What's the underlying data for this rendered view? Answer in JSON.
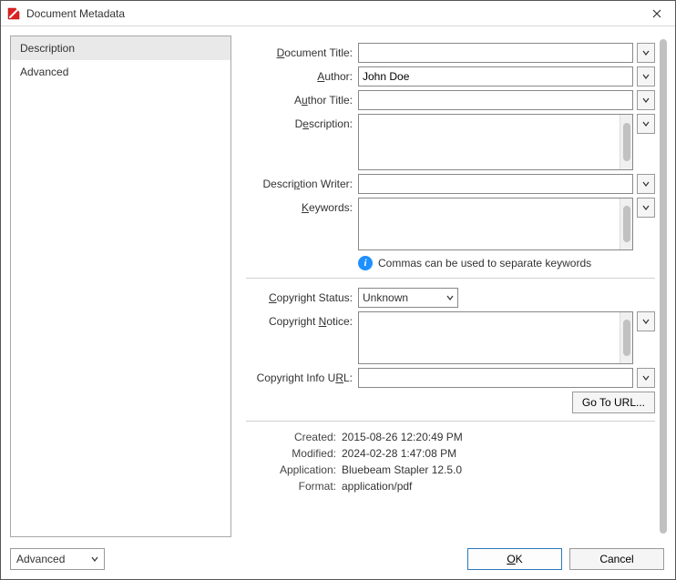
{
  "window": {
    "title": "Document Metadata"
  },
  "sidebar": {
    "items": [
      {
        "id": "description",
        "label": "Description",
        "selected": true
      },
      {
        "id": "advanced",
        "label": "Advanced",
        "selected": false
      }
    ]
  },
  "form": {
    "document_title_label": "Document Title:",
    "document_title_value": "",
    "author_label": "Author:",
    "author_value": "John Doe",
    "author_title_label": "Author Title:",
    "author_title_value": "",
    "description_label": "Description:",
    "description_value": "",
    "description_writer_label": "Description Writer:",
    "description_writer_value": "",
    "keywords_label": "Keywords:",
    "keywords_value": "",
    "keywords_hint": "Commas can be used to separate keywords",
    "copyright_status_label": "Copyright Status:",
    "copyright_status_value": "Unknown",
    "copyright_notice_label": "Copyright Notice:",
    "copyright_notice_value": "",
    "copyright_url_label": "Copyright Info URL:",
    "copyright_url_value": "",
    "goto_url_label": "Go To URL..."
  },
  "meta": {
    "created_label": "Created:",
    "created_value": "2015-08-26 12:20:49 PM",
    "modified_label": "Modified:",
    "modified_value": "2024-02-28 1:47:08 PM",
    "application_label": "Application:",
    "application_value": "Bluebeam Stapler 12.5.0",
    "format_label": "Format:",
    "format_value": "application/pdf"
  },
  "footer": {
    "advanced_label": "Advanced",
    "ok_label": "OK",
    "cancel_label": "Cancel"
  }
}
